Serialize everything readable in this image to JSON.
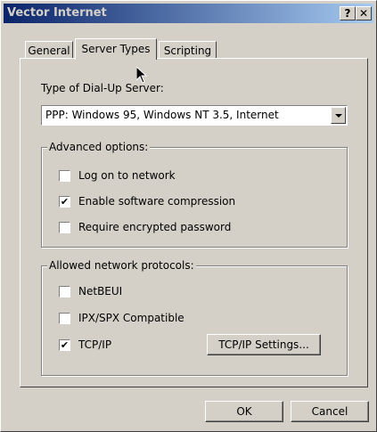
{
  "window": {
    "title": "Vector Internet",
    "help_button": "?",
    "close_button": "✕"
  },
  "tabs": [
    {
      "label": "General",
      "active": false
    },
    {
      "label": "Server Types",
      "active": true
    },
    {
      "label": "Scripting",
      "active": false
    }
  ],
  "dialup_server": {
    "label": "Type of Dial-Up Server:",
    "selected": "PPP: Windows 95, Windows NT 3.5, Internet"
  },
  "advanced_options": {
    "legend": "Advanced options:",
    "items": [
      {
        "label": "Log on to network",
        "checked": false
      },
      {
        "label": "Enable software compression",
        "checked": true
      },
      {
        "label": "Require encrypted password",
        "checked": false
      }
    ]
  },
  "protocols": {
    "legend": "Allowed network protocols:",
    "items": [
      {
        "label": "NetBEUI",
        "checked": false
      },
      {
        "label": "IPX/SPX Compatible",
        "checked": false
      },
      {
        "label": "TCP/IP",
        "checked": true
      }
    ],
    "settings_button": "TCP/IP Settings..."
  },
  "footer": {
    "ok_label": "OK",
    "cancel_label": "Cancel"
  },
  "check_mark": "✔"
}
